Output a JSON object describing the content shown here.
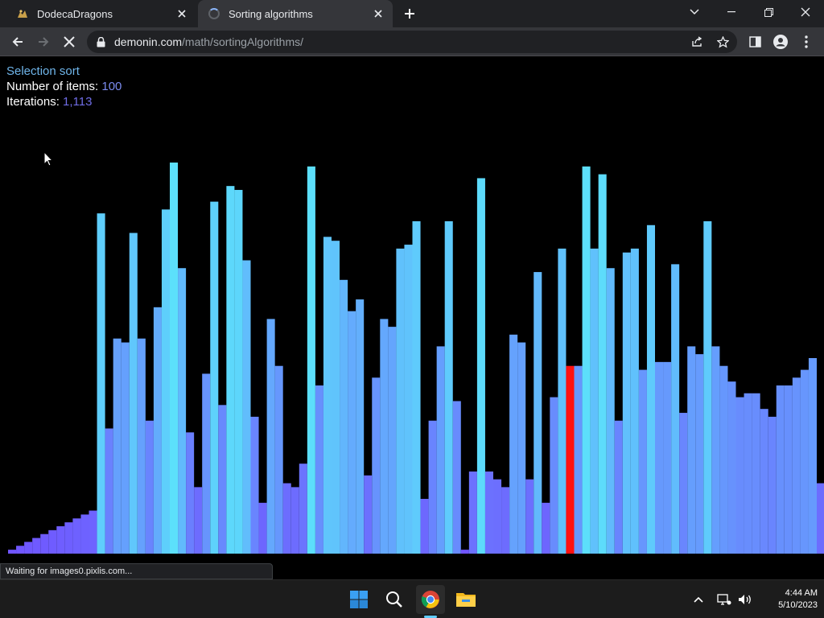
{
  "browser": {
    "tabs": [
      {
        "title": "DodecaDragons",
        "active": false,
        "favicon": "dragon-icon"
      },
      {
        "title": "Sorting algorithms",
        "active": true,
        "favicon": "loading-spinner-icon"
      }
    ],
    "url_domain": "demonin.com",
    "url_path": "/math/sortingAlgorithms/",
    "status_text": "Waiting for images0.pixlis.com..."
  },
  "page": {
    "algorithm": "Selection sort",
    "items_label": "Number of items: ",
    "items_value": "100",
    "iterations_label": "Iterations: ",
    "iterations_value": "1,113"
  },
  "chart_data": {
    "type": "bar",
    "ylim": [
      0,
      100
    ],
    "values": [
      1,
      2,
      3,
      4,
      5,
      6,
      7,
      8,
      9,
      10,
      11,
      87,
      32,
      55,
      54,
      82,
      55,
      34,
      63,
      88,
      100,
      73,
      31,
      17,
      46,
      90,
      38,
      94,
      93,
      75,
      35,
      13,
      60,
      48,
      18,
      17,
      23,
      99,
      43,
      81,
      80,
      70,
      62,
      65,
      20,
      45,
      60,
      58,
      78,
      79,
      85,
      14,
      34,
      53,
      85,
      39,
      1,
      21,
      96,
      21,
      19,
      17,
      56,
      54,
      19,
      72,
      13,
      40,
      78,
      48,
      48,
      99,
      78,
      97,
      73,
      34,
      77,
      78,
      47,
      84,
      49,
      49,
      74,
      36,
      53,
      51,
      85,
      53,
      48,
      44,
      40,
      41,
      41,
      37,
      35,
      43,
      43,
      45,
      47,
      50,
      18,
      0
    ],
    "highlight_index": 69,
    "highlight_color": "#ff1010",
    "color_low": "#7054ff",
    "color_high": "#5ce0fb"
  },
  "taskbar": {
    "time": "4:44 AM",
    "date": "5/10/2023",
    "apps": [
      "windows-start",
      "search",
      "chrome",
      "file-explorer"
    ]
  }
}
